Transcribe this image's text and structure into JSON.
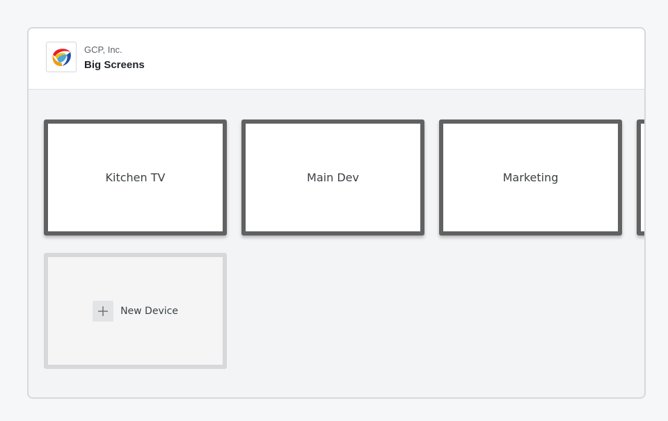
{
  "header": {
    "org_name": "GCP, Inc.",
    "app_title": "Big Screens",
    "logo_icon": "company-logo-icon"
  },
  "devices": [
    {
      "label": "Kitchen TV"
    },
    {
      "label": "Main Dev"
    },
    {
      "label": "Marketing"
    },
    {
      "label": ""
    }
  ],
  "new_device": {
    "label": "New Device",
    "icon": "plus-icon"
  },
  "colors": {
    "screen_bezel": "#616161",
    "background": "#f3f4f6",
    "new_device_border": "#d7d8da"
  }
}
